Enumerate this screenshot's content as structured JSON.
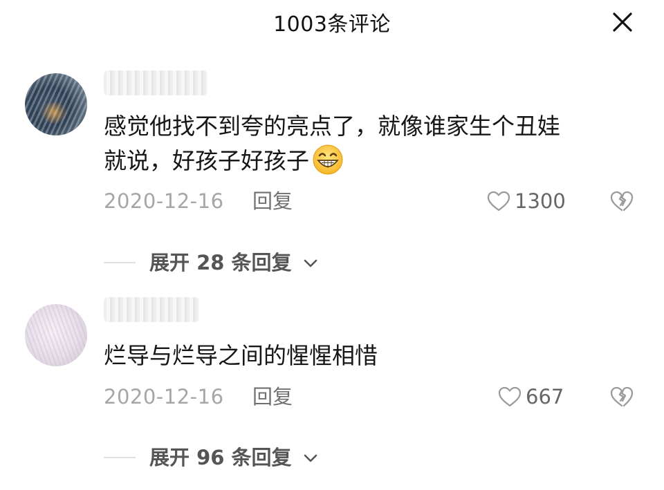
{
  "header": {
    "title": "1003条评论"
  },
  "comments": [
    {
      "text_line1": "感觉他找不到夸的亮点了，就像谁家生个丑娃",
      "text_line2": "就说，好孩子好孩子",
      "emoji": "grinning-face-emoji",
      "date": "2020-12-16",
      "reply_label": "回复",
      "likes": "1300",
      "expand_label": "展开 28 条回复"
    },
    {
      "text_line1": "烂导与烂导之间的惺惺相惜",
      "date": "2020-12-16",
      "reply_label": "回复",
      "likes": "667",
      "expand_label": "展开 96 条回复"
    }
  ],
  "icons": {
    "close": "close-icon",
    "like": "heart-outline-icon",
    "dislike": "broken-heart-icon",
    "expand": "chevron-down-icon"
  },
  "colors": {
    "text_primary": "#161616",
    "text_secondary": "#a6a6a6",
    "icon": "#9a9a9a"
  }
}
